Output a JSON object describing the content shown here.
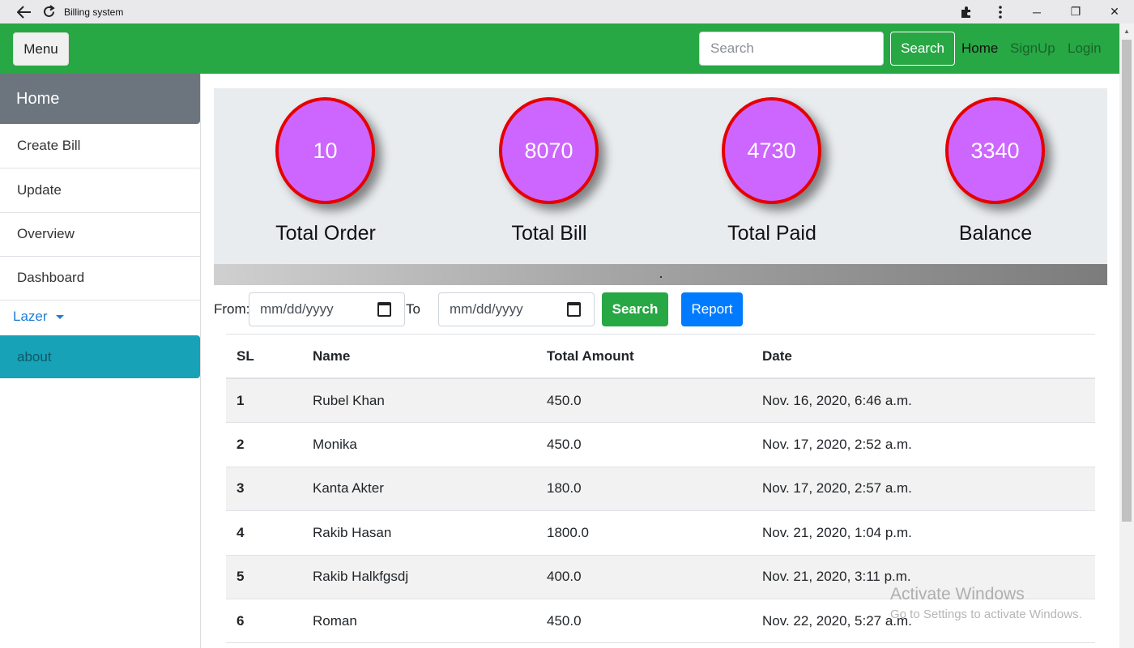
{
  "browser": {
    "title": "Billing system",
    "back_icon": "back-arrow-icon",
    "reload_icon": "reload-icon",
    "extensions_icon": "puzzle-icon",
    "menu_icon": "kebab-menu-icon",
    "minimize": "─",
    "restore": "❐",
    "close": "✕"
  },
  "navbar": {
    "menu_label": "Menu",
    "search_placeholder": "Search",
    "search_button": "Search",
    "links": {
      "home": "Home",
      "signup": "SignUp",
      "login": "Login"
    },
    "color": "#28a745"
  },
  "sidebar": {
    "home": "Home",
    "items": [
      "Create Bill",
      "Update",
      "Overview",
      "Dashboard"
    ],
    "dropdown": "Lazer",
    "about": "about"
  },
  "stats": [
    {
      "value": "10",
      "label": "Total Order"
    },
    {
      "value": "8070",
      "label": "Total Bill"
    },
    {
      "value": "4730",
      "label": "Total Paid"
    },
    {
      "value": "3340",
      "label": "Balance"
    }
  ],
  "filter": {
    "from_label": "From:",
    "to_label": "To",
    "from_placeholder": "mm/dd/yyyy",
    "to_placeholder": "mm/dd/yyyy",
    "search_button": "Search",
    "report_button": "Report"
  },
  "table": {
    "headers": [
      "SL",
      "Name",
      "Total Amount",
      "Date"
    ],
    "rows": [
      {
        "sl": "1",
        "name": "Rubel Khan",
        "amount": "450.0",
        "date": "Nov. 16, 2020, 6:46 a.m."
      },
      {
        "sl": "2",
        "name": "Monika",
        "amount": "450.0",
        "date": "Nov. 17, 2020, 2:52 a.m."
      },
      {
        "sl": "3",
        "name": "Kanta Akter",
        "amount": "180.0",
        "date": "Nov. 17, 2020, 2:57 a.m."
      },
      {
        "sl": "4",
        "name": "Rakib Hasan",
        "amount": "1800.0",
        "date": "Nov. 21, 2020, 1:04 p.m."
      },
      {
        "sl": "5",
        "name": "Rakib Halkfgsdj",
        "amount": "400.0",
        "date": "Nov. 21, 2020, 3:11 p.m."
      },
      {
        "sl": "6",
        "name": "Roman",
        "amount": "450.0",
        "date": "Nov. 22, 2020, 5:27 a.m."
      }
    ]
  },
  "watermark": {
    "line1": "Activate Windows",
    "line2": "Go to Settings to activate Windows."
  }
}
